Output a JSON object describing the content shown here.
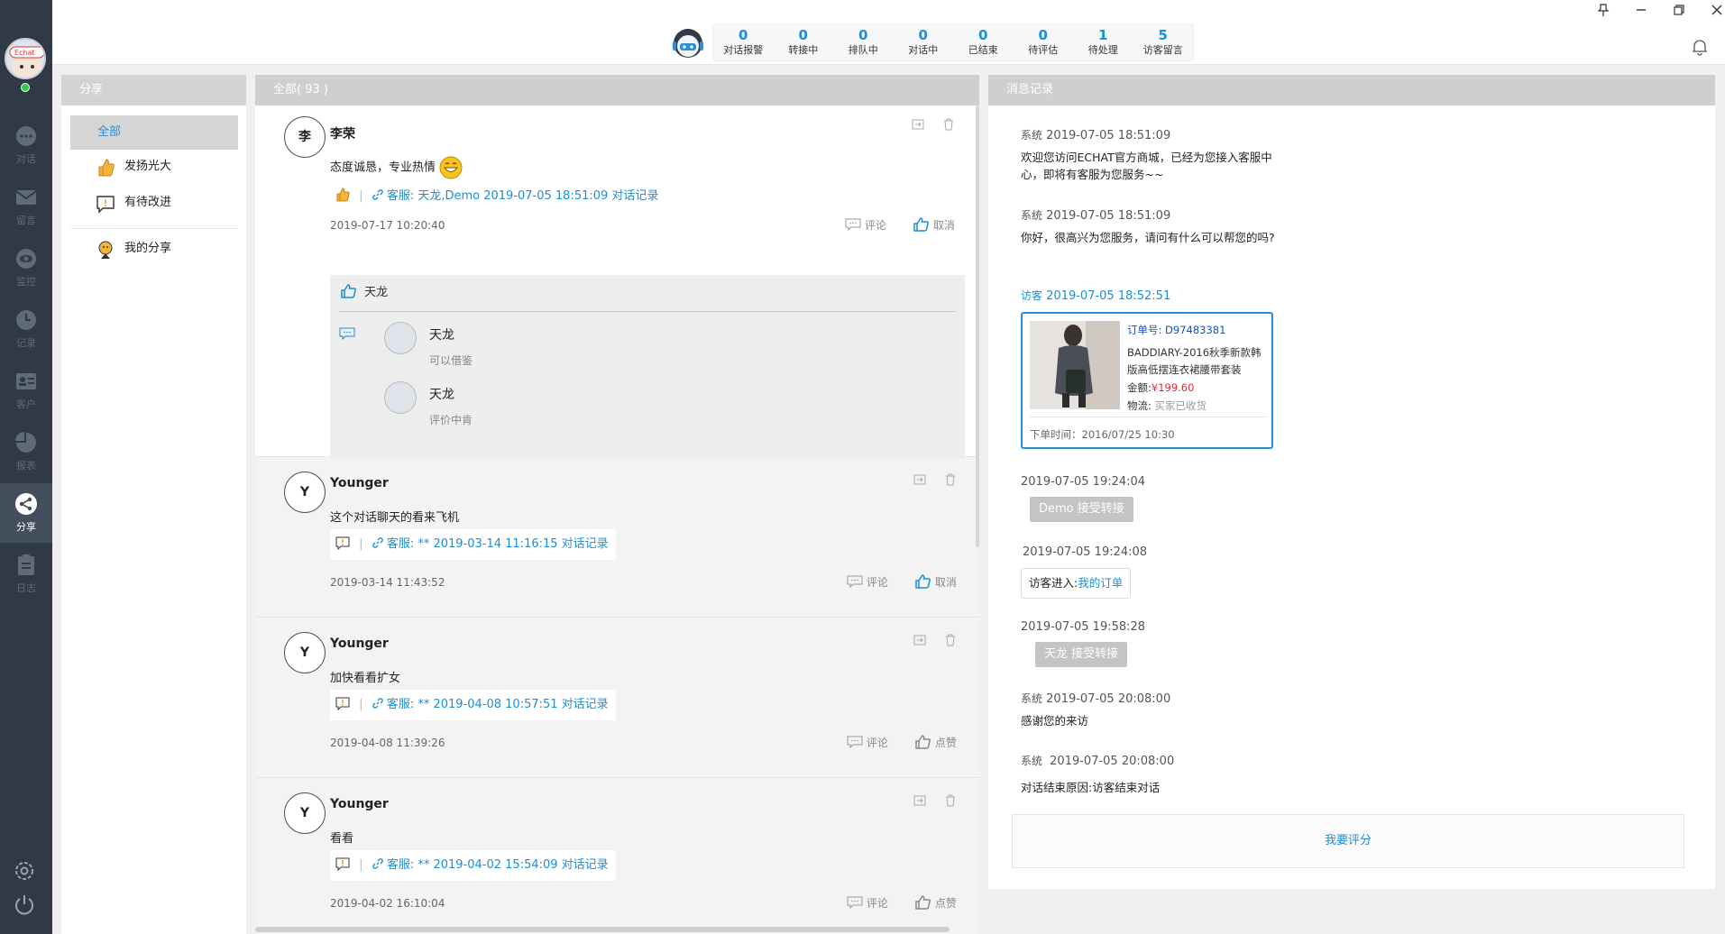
{
  "app": {
    "logo_text": "Echat"
  },
  "nav": {
    "items": [
      {
        "label": "对话",
        "icon": "chat-icon"
      },
      {
        "label": "留言",
        "icon": "mail-icon"
      },
      {
        "label": "监控",
        "icon": "eye-icon"
      },
      {
        "label": "记录",
        "icon": "clock-icon"
      },
      {
        "label": "客户",
        "icon": "contact-card-icon"
      },
      {
        "label": "报表",
        "icon": "pie-chart-icon"
      },
      {
        "label": "分享",
        "icon": "share-icon"
      },
      {
        "label": "日志",
        "icon": "clipboard-icon"
      }
    ],
    "active": "分享"
  },
  "stats": [
    {
      "value": "0",
      "label": "对话报警"
    },
    {
      "value": "0",
      "label": "转接中"
    },
    {
      "value": "0",
      "label": "排队中"
    },
    {
      "value": "0",
      "label": "对话中"
    },
    {
      "value": "0",
      "label": "已结束"
    },
    {
      "value": "0",
      "label": "待评估"
    },
    {
      "value": "1",
      "label": "待处理"
    },
    {
      "value": "5",
      "label": "访客留言"
    }
  ],
  "share_panel": {
    "title": "分享",
    "items": [
      {
        "label": "全部",
        "active": true
      },
      {
        "label": "发扬光大",
        "icon": "thumbs-up-icon"
      },
      {
        "label": "有待改进",
        "icon": "warning-note-icon"
      },
      {
        "label": "我的分享",
        "icon": "person-icon"
      }
    ]
  },
  "feed": {
    "title": "全部( 93 )",
    "cards": [
      {
        "avatar": "李",
        "name": "李荣",
        "text": "态度诚恳，专业热情",
        "link_prefix": "客服:",
        "link_text": "天龙,Demo 2019-07-05 18:51:09 对话记录",
        "date": "2019-07-17 10:20:40",
        "comment": "评论",
        "like_label": "取消",
        "reply_like_name": "天龙",
        "replies": [
          {
            "name": "天龙",
            "text": "可以借鉴"
          },
          {
            "name": "天龙",
            "text": "评价中肯"
          }
        ]
      },
      {
        "avatar": "Y",
        "name": "Younger",
        "text": "这个对话聊天的看来飞机",
        "link_prefix": "客服:",
        "link_text": "** 2019-03-14 11:16:15 对话记录",
        "date": "2019-03-14 11:43:52",
        "comment": "评论",
        "like_label": "取消"
      },
      {
        "avatar": "Y",
        "name": "Younger",
        "text": "加快看看扩女",
        "link_prefix": "客服:",
        "link_text": "** 2019-04-08 10:57:51 对话记录",
        "date": "2019-04-08 11:39:26",
        "comment": "评论",
        "like_label": "点赞"
      },
      {
        "avatar": "Y",
        "name": "Younger",
        "text": "看看",
        "link_prefix": "客服:",
        "link_text": "** 2019-04-02 15:54:09 对话记录",
        "date": "2019-04-02 16:10:04",
        "comment": "评论",
        "like_label": "点赞"
      }
    ]
  },
  "log": {
    "title": "消息记录",
    "entries": [
      {
        "who": "系统",
        "time": "2019-07-05 18:51:09",
        "text": "欢迎您访问ECHAT官方商城，已经为您接入客服中心，即将有客服为您服务~~"
      },
      {
        "who": "系统",
        "time": "2019-07-05 18:51:09",
        "text": "你好，很高兴为您服务，请问有什么可以帮您的吗?"
      },
      {
        "who": "访客",
        "time": "2019-07-05 18:52:51"
      },
      {
        "time": "2019-07-05 19:24:04",
        "badge": "Demo 接受转接"
      },
      {
        "time": "2019-07-05 19:24:08",
        "box_label": "访客进入:",
        "box_link": "我的订单"
      },
      {
        "time": "2019-07-05 19:58:28",
        "badge": "天龙 接受转接"
      },
      {
        "who": "系统",
        "time": "2019-07-05 20:08:00",
        "text": "感谢您的来访"
      },
      {
        "who": "系统",
        "time": "2019-07-05 20:08:00",
        "text": "对话结束原因:访客结束对话"
      }
    ],
    "order": {
      "no_label": "订单号:",
      "no": "D97483381",
      "title": "BADDIARY-2016秋季新款韩版高低摆连衣裙腰带套装",
      "amount_label": "金额:",
      "amount": "¥199.60",
      "ship_label": "物流:",
      "ship": "买家已收货",
      "time": "下单时间：2016/07/25 10:30"
    },
    "rate_label": "我要评分"
  },
  "colors": {
    "accent": "#1a8fd6",
    "nav_bg": "#2f3a46",
    "price": "#e8262c"
  }
}
